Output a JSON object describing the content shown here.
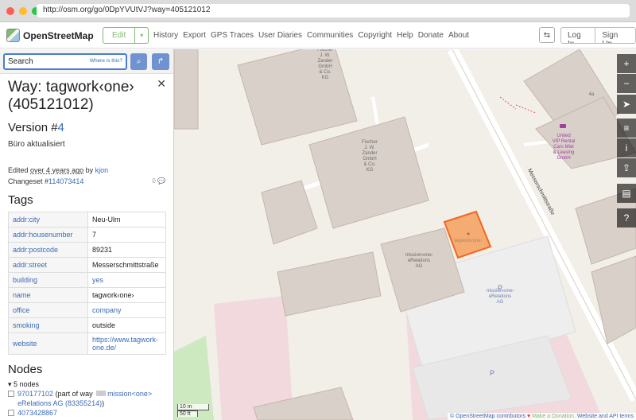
{
  "browser": {
    "url": "http://osm.org/go/0DpYVUtVJ?way=405121012"
  },
  "header": {
    "logo_text": "OpenStreetMap",
    "edit_label": "Edit",
    "nav": [
      "History",
      "Export",
      "GPS Traces",
      "User Diaries",
      "Communities",
      "Copyright",
      "Help",
      "Donate",
      "About"
    ],
    "login": "Log In",
    "signup": "Sign Up"
  },
  "search": {
    "placeholder": "Search",
    "where": "Where is this?"
  },
  "feature": {
    "title": "Way: tagwork‹one› (405121012)",
    "version_prefix": "Version #",
    "version_num": "4",
    "description": "Büro aktualisiert",
    "edited_prefix": "Edited",
    "edited_when": "over 4 years ago",
    "edited_by": "by",
    "user": "kjon",
    "changeset_prefix": "Changeset #",
    "changeset": "114073414",
    "comments": "0"
  },
  "tags_title": "Tags",
  "tags": [
    {
      "k": "addr:city",
      "v": "Neu-Ulm",
      "link": false
    },
    {
      "k": "addr:housenumber",
      "v": "7",
      "link": false
    },
    {
      "k": "addr:postcode",
      "v": "89231",
      "link": false
    },
    {
      "k": "addr:street",
      "v": "Messerschmittstraße",
      "link": false
    },
    {
      "k": "building",
      "v": "yes",
      "link": true
    },
    {
      "k": "name",
      "v": "tagwork‹one›",
      "link": false
    },
    {
      "k": "office",
      "v": "company",
      "link": true
    },
    {
      "k": "smoking",
      "v": "outside",
      "link": false
    },
    {
      "k": "website",
      "v": "https://www.tagwork-one.de/",
      "link": true
    }
  ],
  "nodes_title": "Nodes",
  "nodes_count": "▾ 5 nodes",
  "nodes": [
    {
      "id": "970177102",
      "pre": " (part of way ",
      "way": "mission<one> eRelations AG (83355214)",
      "post": ")"
    },
    {
      "id": "4073428867",
      "pre": "",
      "way": "",
      "post": ""
    }
  ],
  "map": {
    "labels": {
      "fischer1": [
        "Fischer",
        "J. W.",
        "Zander",
        "GmbH",
        "& Co.",
        "KG"
      ],
      "fischer2": [
        "Fischer",
        "J. W.",
        "Zander",
        "GmbH",
        "& Co.",
        "KG"
      ],
      "mission": [
        "mission‹one›",
        "eRelations",
        "AG"
      ],
      "mission_parking": [
        "mission‹one›",
        "eRelations",
        "AG"
      ],
      "united": [
        "United",
        "VIP Rental",
        "Cars Miet",
        "& Leasing",
        "GmbH"
      ],
      "street": "Messerschmittstraße",
      "tagwork": "tagwork‹one›",
      "hn": "4a",
      "p": "P"
    },
    "controls": [
      "+",
      "−",
      "➤",
      "≡",
      "i",
      "⇪",
      "▤",
      "?"
    ],
    "scale_m": "10 m",
    "scale_ft": "50 ft",
    "attribution": {
      "a": "© OpenStreetMap contributors",
      "b": "Make a Donation.",
      "c": "Website and API terms"
    }
  }
}
